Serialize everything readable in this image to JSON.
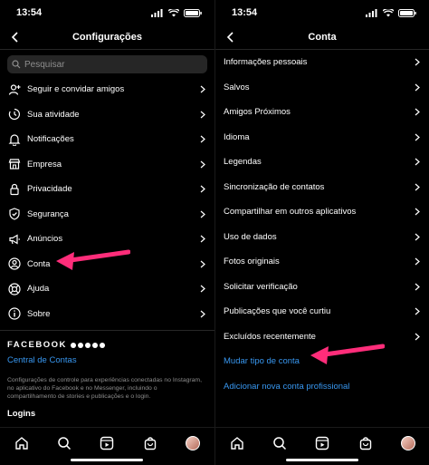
{
  "left": {
    "status_time": "13:54",
    "title": "Configurações",
    "search_placeholder": "Pesquisar",
    "items": [
      {
        "label": "Seguir e convidar amigos",
        "icon": "add-person-icon"
      },
      {
        "label": "Sua atividade",
        "icon": "activity-clock-icon"
      },
      {
        "label": "Notificações",
        "icon": "bell-icon"
      },
      {
        "label": "Empresa",
        "icon": "shop-icon"
      },
      {
        "label": "Privacidade",
        "icon": "lock-icon"
      },
      {
        "label": "Segurança",
        "icon": "shield-icon"
      },
      {
        "label": "Anúncios",
        "icon": "megaphone-icon"
      },
      {
        "label": "Conta",
        "icon": "account-circle-icon"
      },
      {
        "label": "Ajuda",
        "icon": "lifebuoy-icon"
      },
      {
        "label": "Sobre",
        "icon": "info-icon"
      }
    ],
    "facebook": {
      "brand": "FACEBOOK",
      "link": "Central de Contas",
      "description": "Configurações de controle para experiências conectadas no Instagram, no aplicativo do Facebook e no Messenger, incluindo o compartilhamento de stories e publicações e o login."
    },
    "logins_label": "Logins"
  },
  "right": {
    "status_time": "13:54",
    "title": "Conta",
    "items": [
      {
        "label": "Informações pessoais"
      },
      {
        "label": "Salvos"
      },
      {
        "label": "Amigos Próximos"
      },
      {
        "label": "Idioma"
      },
      {
        "label": "Legendas"
      },
      {
        "label": "Sincronização de contatos"
      },
      {
        "label": "Compartilhar em outros aplicativos"
      },
      {
        "label": "Uso de dados"
      },
      {
        "label": "Fotos originais"
      },
      {
        "label": "Solicitar verificação"
      },
      {
        "label": "Publicações que você curtiu"
      },
      {
        "label": "Excluídos recentemente"
      }
    ],
    "links": [
      "Mudar tipo de conta",
      "Adicionar nova conta profissional"
    ]
  },
  "tabbar": [
    "home-icon",
    "search-icon",
    "reels-icon",
    "shop-bag-icon",
    "profile-avatar"
  ],
  "colors": {
    "background": "#000000",
    "link": "#3897f0",
    "arrow": "#ff2d7a",
    "secondary": "#8e8e8e"
  }
}
